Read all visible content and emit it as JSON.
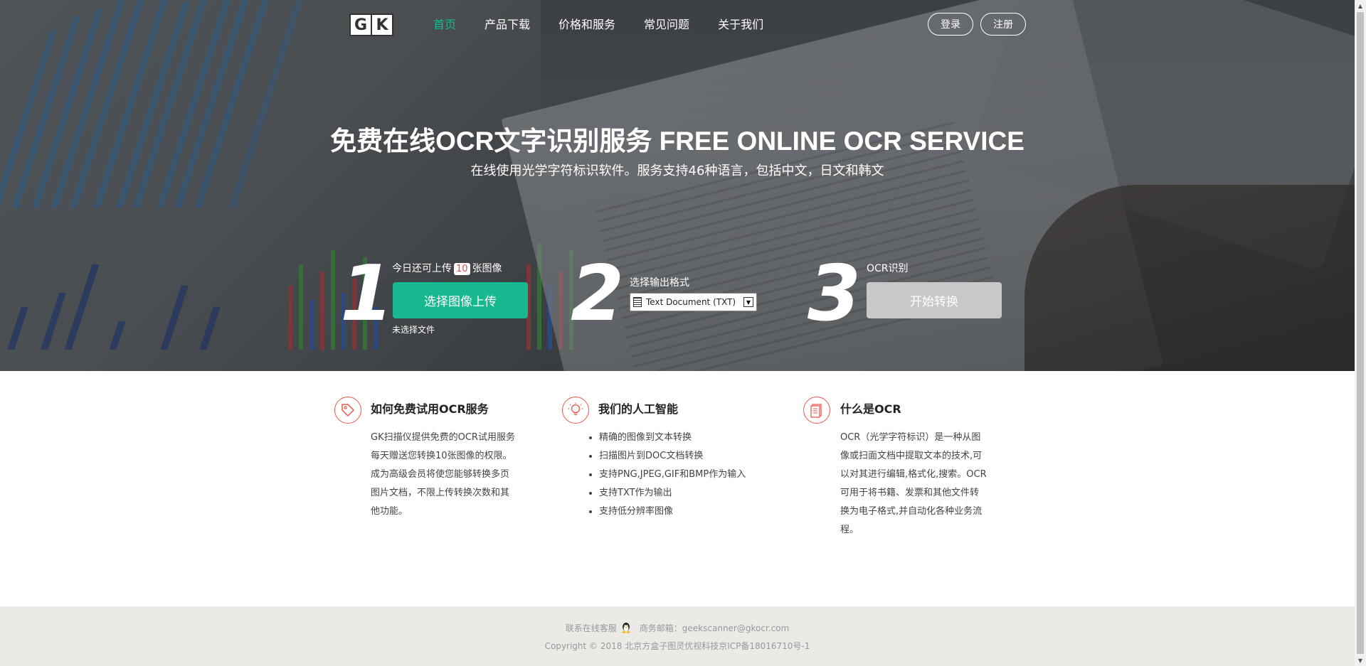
{
  "nav": {
    "logo_g": "G",
    "logo_k": "K",
    "items": [
      {
        "label": "首页",
        "active": true
      },
      {
        "label": "产品下载",
        "active": false
      },
      {
        "label": "价格和服务",
        "active": false
      },
      {
        "label": "常见问题",
        "active": false
      },
      {
        "label": "关于我们",
        "active": false
      }
    ],
    "login_label": "登录",
    "register_label": "注册"
  },
  "hero": {
    "title": "免费在线OCR文字识别服务 FREE ONLINE OCR SERVICE",
    "subtitle": "在线使用光学字符标识软件。服务支持46种语言，包括中文，日文和韩文"
  },
  "steps": {
    "step1": {
      "number": "1",
      "label_prefix": "今日还可上传",
      "quota": "10",
      "label_suffix": "张图像",
      "button": "选择图像上传",
      "no_file": "未选择文件"
    },
    "step2": {
      "number": "2",
      "label": "选择输出格式",
      "selected": "Text Document (TXT)"
    },
    "step3": {
      "number": "3",
      "label": "OCR识别",
      "button": "开始转换"
    }
  },
  "features": {
    "f1": {
      "title": "如何免费试用OCR服务",
      "lines": [
        "GK扫描仪提供免费的OCR试用服务",
        "每天赠送您转换10张图像的权限。",
        "成为高级会员将使您能够转换多页",
        "图片文档，不限上传转换次数和其",
        "他功能。"
      ]
    },
    "f2": {
      "title": "我们的人工智能",
      "items": [
        "精确的图像到文本转换",
        "扫描图片到DOC文档转换",
        "支持PNG,JPEG,GIF和BMP作为输入",
        "支持TXT作为输出",
        "支持低分辨率图像"
      ]
    },
    "f3": {
      "title": "什么是OCR",
      "lines": [
        "OCR（光学字符标识）是一种从图",
        "像或扫面文档中提取文本的技术,可",
        "以对其进行编辑,格式化,搜索。OCR",
        "可用于将书籍、发票和其他文件转",
        "换为电子格式,并自动化各种业务流",
        "程。"
      ]
    }
  },
  "footer": {
    "contact": "联系在线客服",
    "email": "商务邮箱：geekscanner@gkocr.com",
    "copyright": "Copyright © 2018 北京方盒子图灵优视科技京ICP备18016710号-1"
  },
  "colors": {
    "accent": "#17b890",
    "feature_icon": "#e55a4e",
    "disabled_button": "#c8c8c8",
    "footer_bg": "#eceae6"
  },
  "icons": [
    "gk-logo",
    "tag-icon",
    "lightbulb-icon",
    "document-icon",
    "qq-penguin-icon",
    "text-document-icon",
    "dropdown-arrow-icon"
  ]
}
